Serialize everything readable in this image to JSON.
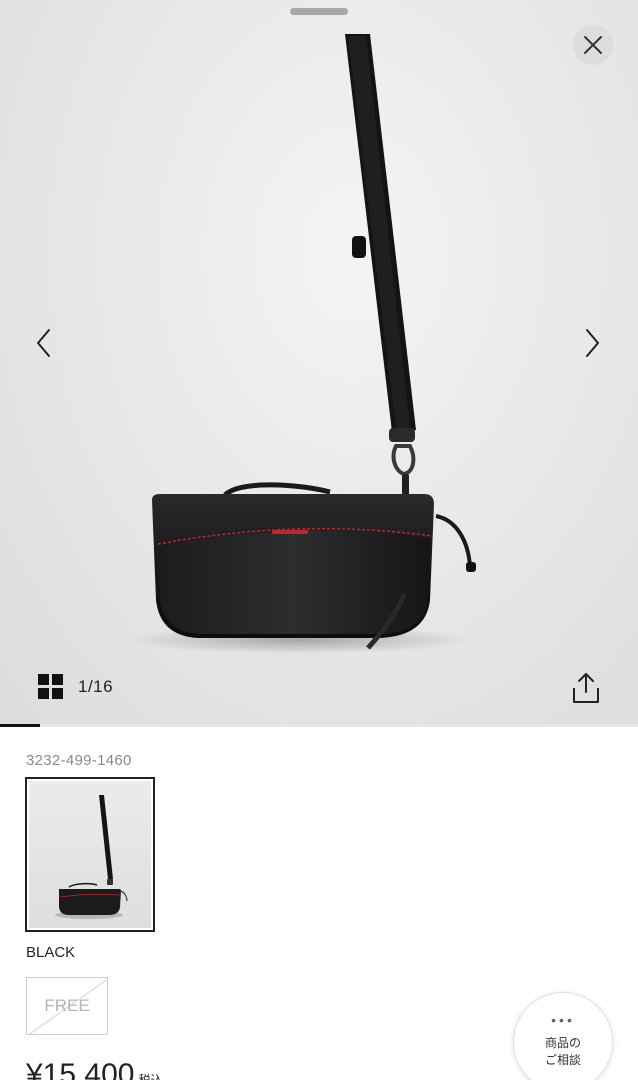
{
  "viewer": {
    "counter": "1/16",
    "progress": 0.0625,
    "icons": {
      "close": "close-icon",
      "prev": "chevron-left-icon",
      "next": "chevron-right-icon",
      "grid": "grid-icon",
      "share": "share-icon"
    }
  },
  "product": {
    "code": "3232-499-1460",
    "color": "BLACK",
    "size": "FREE",
    "size_available": false,
    "price": "¥15,400",
    "tax_label": "税込"
  },
  "consult": {
    "dots": "•••",
    "line1": "商品の",
    "line2": "ご相談"
  },
  "colors": {
    "accent": "#111111",
    "product_stitch": "#c0262b"
  }
}
